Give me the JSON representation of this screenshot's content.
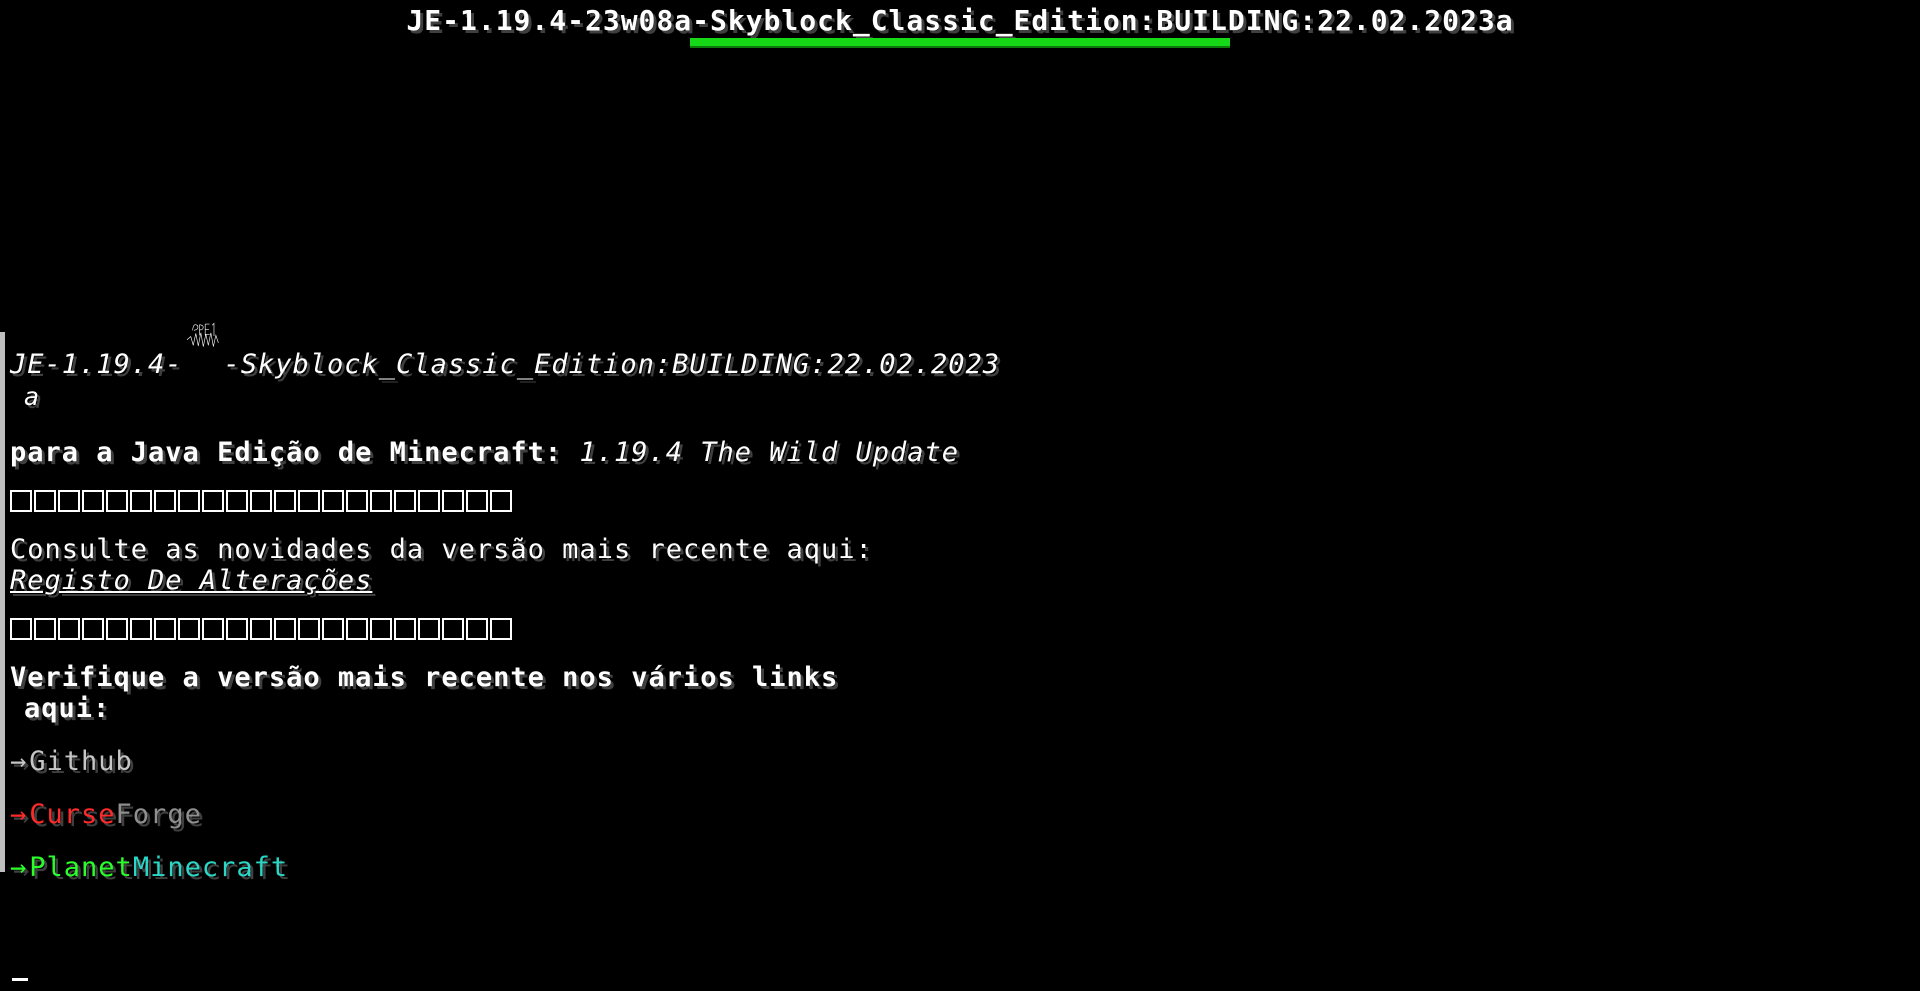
{
  "loading": {
    "title": "JE-1.19.4-23w08a-Skyblock_Classic_Edition:BUILDING:22.02.2023a",
    "progress": 1.0
  },
  "info": {
    "header_prefix": "JE-1.19.4-",
    "signature_text": "PRE1",
    "header_suffix": "-Skyblock_Classic_Edition:BUILDING:22.02.2023",
    "header_tail": "a",
    "edition_label": "para a Java Edição de Minecraft:",
    "edition_version": "1.19.4 The Wild Update",
    "changelog_prompt": "Consulte as novidades da versão mais recente aqui:",
    "changelog_link": "Registo De Alterações",
    "links_prompt_line1": "Verifique a versão mais recente nos vários links",
    "links_prompt_line2": "aqui:",
    "links": [
      {
        "arrow": "→",
        "part1": "Github",
        "part2": "",
        "color1": "#c6c6c6",
        "color2": "#c6c6c6",
        "arrow_color": "#c6c6c6"
      },
      {
        "arrow": "→",
        "part1": "Curse",
        "part2": "Forge",
        "color1": "#ff2a2a",
        "color2": "#8f8f8f",
        "arrow_color": "#ff2a2a"
      },
      {
        "arrow": "→",
        "part1": "Planet",
        "part2": "Minecraft",
        "color1": "#2bff2b",
        "color2": "#2bd6c6",
        "arrow_color": "#2bff2b"
      }
    ]
  },
  "colors": {
    "background": "#000000",
    "progress": "#17d817",
    "text": "#ffffff"
  }
}
